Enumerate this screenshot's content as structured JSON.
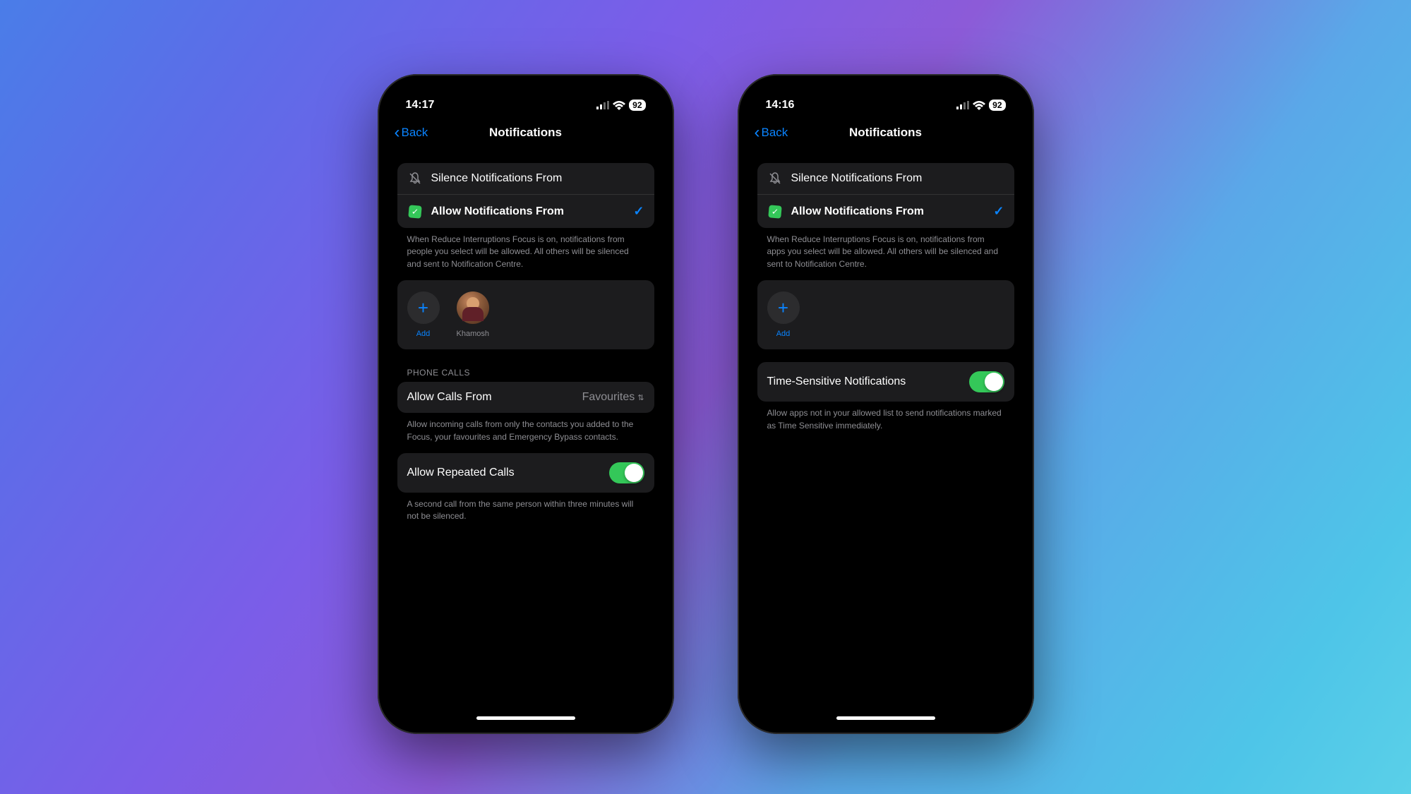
{
  "phone_left": {
    "status": {
      "time": "14:17",
      "battery": "92"
    },
    "nav": {
      "back": "Back",
      "title": "Notifications"
    },
    "options": {
      "silence": "Silence Notifications From",
      "allow": "Allow Notifications From"
    },
    "allow_footer": "When Reduce Interruptions Focus is on, notifications from people you select will be allowed. All others will be silenced and sent to Notification Centre.",
    "add_label": "Add",
    "person_name": "Khamosh",
    "phone_calls_header": "PHONE CALLS",
    "allow_calls_label": "Allow Calls From",
    "allow_calls_value": "Favourites",
    "allow_calls_footer": "Allow incoming calls from only the contacts you added to the Focus, your favourites and Emergency Bypass contacts.",
    "repeated_label": "Allow Repeated Calls",
    "repeated_footer": "A second call from the same person within three minutes will not be silenced."
  },
  "phone_right": {
    "status": {
      "time": "14:16",
      "battery": "92"
    },
    "nav": {
      "back": "Back",
      "title": "Notifications"
    },
    "options": {
      "silence": "Silence Notifications From",
      "allow": "Allow Notifications From"
    },
    "allow_footer": "When Reduce Interruptions Focus is on, notifications from apps you select will be allowed. All others will be silenced and sent to Notification Centre.",
    "add_label": "Add",
    "time_sensitive_label": "Time-Sensitive Notifications",
    "time_sensitive_footer": "Allow apps not in your allowed list to send notifications marked as Time Sensitive immediately."
  }
}
